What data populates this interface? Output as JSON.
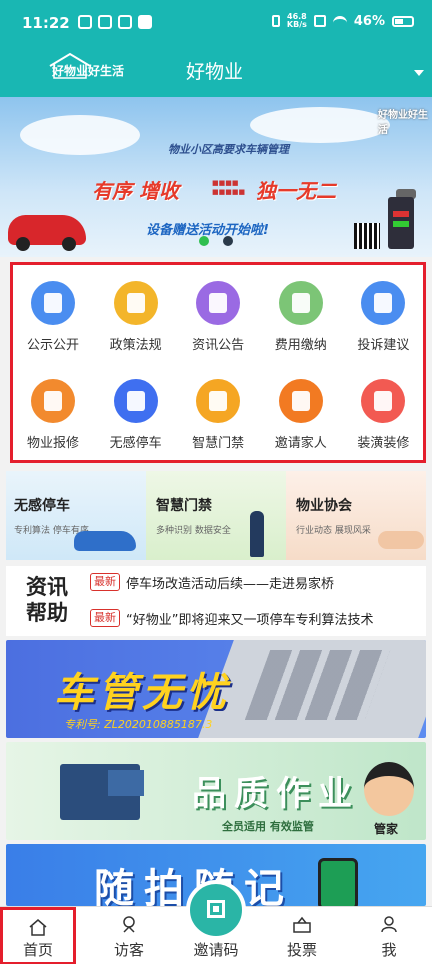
{
  "status_bar": {
    "time": "11:22",
    "net_speed_value": "46.8",
    "net_speed_unit": "KB/s",
    "battery": "46%"
  },
  "header": {
    "logo_text": "好物业好生活",
    "title": "好物业",
    "dropdown_icon": "chevron-down-icon"
  },
  "banner": {
    "logo_text": "好物业好生活",
    "subtitle": "物业小区高要求车辆管理",
    "slogan_left": "有序 增收",
    "slogan_right": "独一无二",
    "promo": "设备赠送活动开始啦!",
    "active_dot_color": "#2fbf4f",
    "inactive_dot_color": "#2a3a4a"
  },
  "menu": {
    "items": [
      {
        "label": "公示公开",
        "icon": "notice-board-icon",
        "color": "#4a8df0"
      },
      {
        "label": "政策法规",
        "icon": "house-policy-icon",
        "color": "#f3b52a"
      },
      {
        "label": "资讯公告",
        "icon": "news-save-icon",
        "color": "#9a6ae3"
      },
      {
        "label": "费用缴纳",
        "icon": "money-bag-icon",
        "color": "#7cc576"
      },
      {
        "label": "投诉建议",
        "icon": "mail-complaint-icon",
        "color": "#4a8df0"
      },
      {
        "label": "物业报修",
        "icon": "wrench-icon",
        "color": "#f28a2e"
      },
      {
        "label": "无感停车",
        "icon": "parking-car-icon",
        "color": "#3f6ff0"
      },
      {
        "label": "智慧门禁",
        "icon": "smart-gate-icon",
        "color": "#f5a623"
      },
      {
        "label": "邀请家人",
        "icon": "invite-icon",
        "color": "#f27a22"
      },
      {
        "label": "装潢装修",
        "icon": "house-decor-icon",
        "color": "#f25a52"
      }
    ]
  },
  "feature_cards": [
    {
      "title": "无感停车",
      "sub": "专利算法    停车有序"
    },
    {
      "title": "智慧门禁",
      "sub": "多种识别    数据安全"
    },
    {
      "title": "物业协会",
      "sub": "行业动态    展现风采"
    }
  ],
  "news": {
    "logo_line1": "资讯",
    "logo_line2": "帮助",
    "items": [
      {
        "tag": "最新",
        "text": "停车场改造活动后续——走进易家桥"
      },
      {
        "tag": "最新",
        "text": "“好物业”即将迎来又一项停车专利算法技术"
      }
    ]
  },
  "promos": {
    "parking": {
      "headline": "车管无忧",
      "patent": "专利号: ZL202010885187.3"
    },
    "quality": {
      "headline": "品质作业",
      "subline": "全员适用    有效监管",
      "badge": "管家"
    },
    "snapshot": {
      "headline": "随拍随记"
    }
  },
  "tabbar": {
    "items": [
      {
        "label": "首页",
        "icon": "home-icon"
      },
      {
        "label": "访客",
        "icon": "visitor-icon"
      },
      {
        "label": "邀请码",
        "icon": "qr-code-icon"
      },
      {
        "label": "投票",
        "icon": "vote-icon"
      },
      {
        "label": "我",
        "icon": "profile-icon"
      }
    ],
    "accent": "#2ab5a6"
  }
}
